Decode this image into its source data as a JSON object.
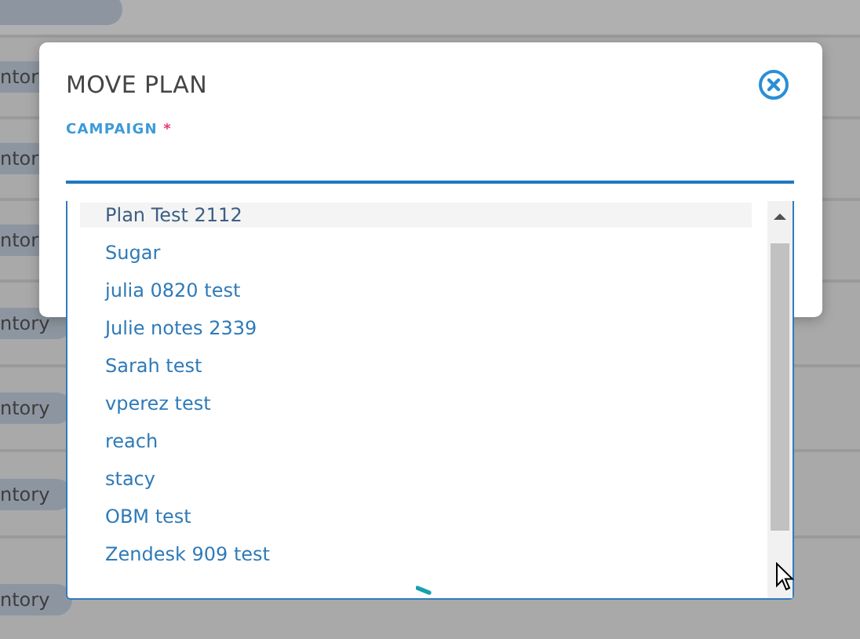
{
  "background_rows": [
    {
      "label": "ntor"
    },
    {
      "label": "ntor"
    },
    {
      "label": "ntor"
    },
    {
      "label": "ntory"
    },
    {
      "label": "ntory"
    },
    {
      "label": "ntory"
    },
    {
      "label": "ntory"
    }
  ],
  "dialog": {
    "title": "MOVE PLAN",
    "field": {
      "label": "CAMPAIGN",
      "required_mark": "*"
    },
    "options": [
      {
        "label": "Plan Test 2112",
        "selected": true
      },
      {
        "label": "Sugar",
        "selected": false
      },
      {
        "label": "julia 0820 test",
        "selected": false
      },
      {
        "label": "Julie notes 2339",
        "selected": false
      },
      {
        "label": "Sarah test",
        "selected": false
      },
      {
        "label": "vperez test",
        "selected": false
      },
      {
        "label": "reach",
        "selected": false
      },
      {
        "label": "stacy",
        "selected": false
      },
      {
        "label": "OBM test",
        "selected": false
      },
      {
        "label": "Zendesk 909 test",
        "selected": false
      }
    ]
  }
}
